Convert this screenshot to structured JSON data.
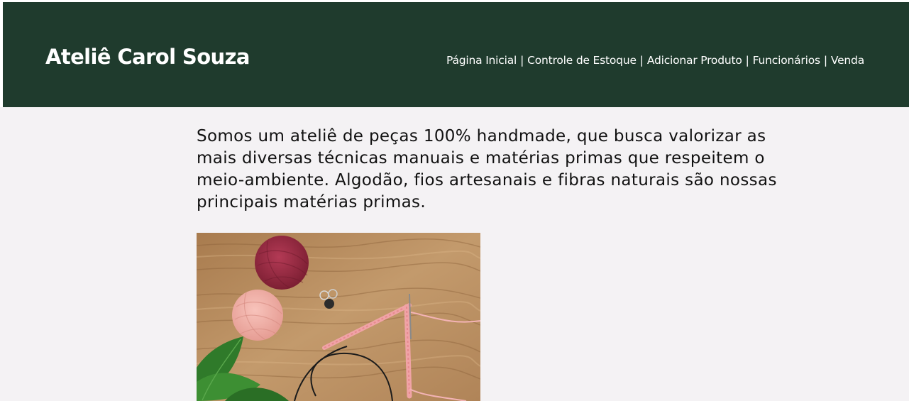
{
  "header": {
    "brand": "Ateliê Carol Souza",
    "nav": [
      {
        "label": "Página Inicial"
      },
      {
        "label": "Controle de Estoque"
      },
      {
        "label": "Adicionar Produto"
      },
      {
        "label": "Funcionários"
      },
      {
        "label": "Venda"
      }
    ],
    "separator": "|",
    "background_color": "#1f3b2d"
  },
  "main": {
    "intro_text": "Somos um ateliê de peças 100% handmade, que busca valorizar as mais diversas técnicas manuais e matérias primas que respeitem o meio-ambiente. Algodão, fios artesanais e fibras naturais são nossas principais matérias primas.",
    "photo": {
      "icon": "knitting-photo",
      "colors": {
        "wood": "#b58859",
        "yarn_red": "#9b2b43",
        "yarn_pink": "#f2b0a8",
        "leaf": "#2f7a2a"
      }
    }
  }
}
